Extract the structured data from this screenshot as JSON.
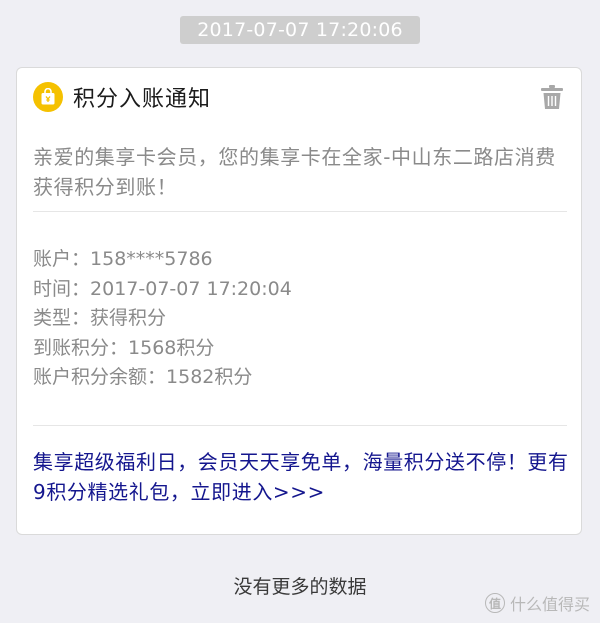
{
  "message": {
    "timestamp": "2017-07-07 17:20:06"
  },
  "card": {
    "title": "积分入账通知",
    "intro": "亲爱的集享卡会员，您的集享卡在全家-中山东二路店消费获得积分到账！",
    "details": [
      {
        "label": "账户：",
        "value": "158****5786"
      },
      {
        "label": "时间：",
        "value": "2017-07-07 17:20:04"
      },
      {
        "label": "类型：",
        "value": "获得积分"
      },
      {
        "label": "到账积分：",
        "value": "1568积分"
      },
      {
        "label": "账户积分余额：",
        "value": "1582积分"
      }
    ],
    "promo": "集享超级福利日，会员天天享免单，海量积分送不停！更有9积分精选礼包，立即进入>>>"
  },
  "footer": {
    "no_more": "没有更多的数据"
  },
  "watermark": {
    "badge": "值",
    "text": "什么值得买"
  },
  "colors": {
    "background": "#efeff4",
    "timestamp_bg": "#cecece",
    "app_icon": "#f5c100",
    "link": "#14168e",
    "muted_text": "#8a8a8a"
  },
  "icons": {
    "app": "shopping-bag-icon",
    "delete": "trash-icon"
  }
}
